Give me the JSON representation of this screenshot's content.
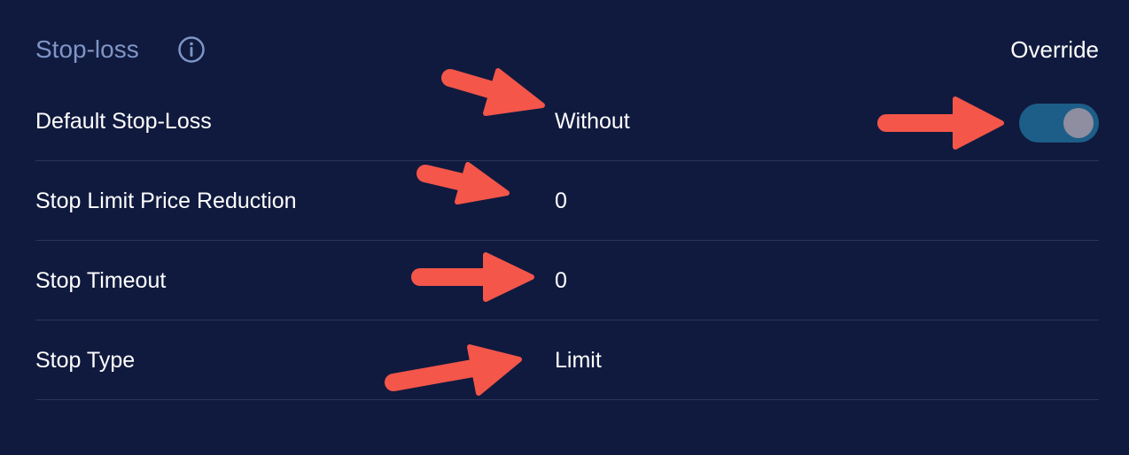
{
  "section": {
    "title": "Stop-loss",
    "info_icon": "info-circle-icon",
    "override_label": "Override"
  },
  "rows": [
    {
      "label": "Default Stop-Loss",
      "value": "Without",
      "override_enabled": true
    },
    {
      "label": "Stop Limit Price Reduction",
      "value": "0"
    },
    {
      "label": "Stop Timeout",
      "value": "0"
    },
    {
      "label": "Stop Type",
      "value": "Limit"
    }
  ],
  "colors": {
    "background": "#101a3e",
    "title": "#7f95c6",
    "toggle_track": "#1c5e87",
    "toggle_knob": "#8e8ea0",
    "annotation_arrow": "#f4564a",
    "divider": "#2a3558"
  }
}
